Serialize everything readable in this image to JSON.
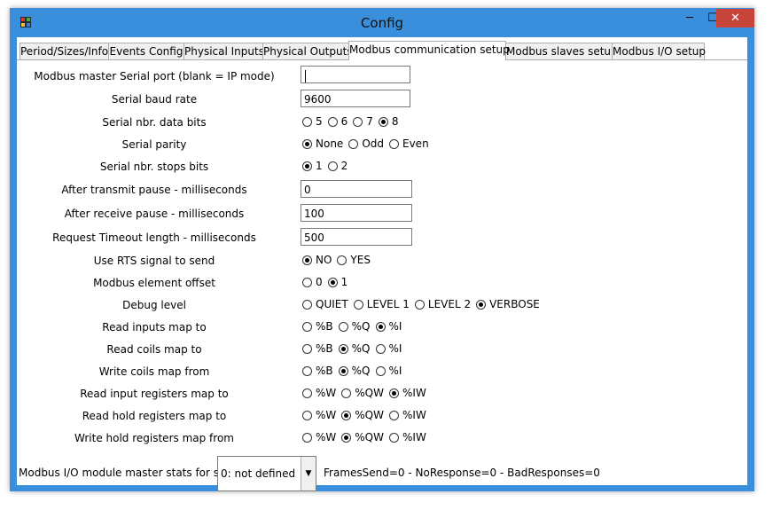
{
  "window": {
    "title": "Config",
    "minimize_label": "─",
    "maximize_label": "☐",
    "close_label": "✕"
  },
  "tabs": [
    {
      "label": "Period/Sizes/Info",
      "active": false
    },
    {
      "label": "Events Config",
      "active": false
    },
    {
      "label": "Physical Inputs",
      "active": false
    },
    {
      "label": "Physical Outputs",
      "active": false
    },
    {
      "label": "Modbus communication setup",
      "active": true
    },
    {
      "label": "Modbus slaves setup",
      "active": false
    },
    {
      "label": "Modbus I/O setup",
      "active": false
    }
  ],
  "form": {
    "serial_port": {
      "label": "Modbus master Serial port (blank = IP mode)",
      "value": ""
    },
    "baud_rate": {
      "label": "Serial baud rate",
      "value": "9600"
    },
    "data_bits": {
      "label": "Serial nbr. data bits",
      "options": [
        "5",
        "6",
        "7",
        "8"
      ],
      "selected": "8"
    },
    "parity": {
      "label": "Serial parity",
      "options": [
        "None",
        "Odd",
        "Even"
      ],
      "selected": "None"
    },
    "stop_bits": {
      "label": "Serial nbr. stops bits",
      "options": [
        "1",
        "2"
      ],
      "selected": "1"
    },
    "after_transmit": {
      "label": "After transmit pause - milliseconds",
      "value": "0"
    },
    "after_receive": {
      "label": "After receive pause - milliseconds",
      "value": "100"
    },
    "timeout": {
      "label": "Request Timeout length - milliseconds",
      "value": "500"
    },
    "rts": {
      "label": "Use RTS signal to send",
      "options": [
        "NO",
        "YES"
      ],
      "selected": "NO"
    },
    "element_offset": {
      "label": "Modbus element offset",
      "options": [
        "0",
        "1"
      ],
      "selected": "1"
    },
    "debug_level": {
      "label": "Debug level",
      "options": [
        "QUIET",
        "LEVEL 1",
        "LEVEL 2",
        "VERBOSE"
      ],
      "selected": "VERBOSE"
    },
    "read_inputs": {
      "label": "Read inputs map to",
      "options": [
        "%B",
        "%Q",
        "%I"
      ],
      "selected": "%I"
    },
    "read_coils": {
      "label": "Read coils map to",
      "options": [
        "%B",
        "%Q",
        "%I"
      ],
      "selected": "%Q"
    },
    "write_coils": {
      "label": "Write coils map from",
      "options": [
        "%B",
        "%Q",
        "%I"
      ],
      "selected": "%Q"
    },
    "read_input_registers": {
      "label": "Read input registers map to",
      "options": [
        "%W",
        "%QW",
        "%IW"
      ],
      "selected": "%IW"
    },
    "read_hold_registers": {
      "label": "Read hold registers map to",
      "options": [
        "%W",
        "%QW",
        "%IW"
      ],
      "selected": "%QW"
    },
    "write_hold_registers": {
      "label": "Write hold registers map from",
      "options": [
        "%W",
        "%QW",
        "%IW"
      ],
      "selected": "%QW"
    }
  },
  "stats": {
    "label": "Modbus I/O module master stats for slave:",
    "slave_selected": "0: not defined",
    "text": "FramesSend=0 - NoResponse=0 - BadResponses=0"
  }
}
